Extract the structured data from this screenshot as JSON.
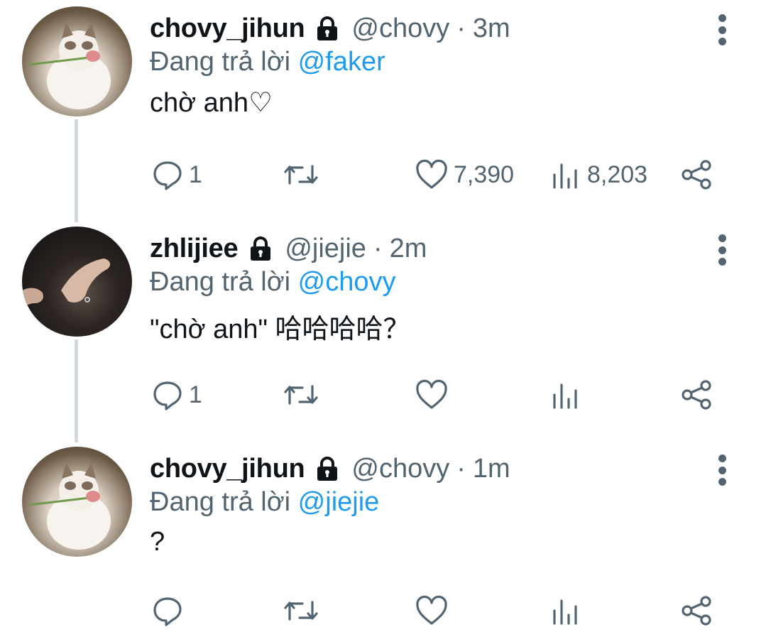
{
  "tweets": [
    {
      "name": "chovy_jihun",
      "handle": "@chovy",
      "separator": "·",
      "time": "3m",
      "reply_prefix": "Đang trả lời",
      "reply_to": "@faker",
      "text": "chờ anh♡",
      "counts": {
        "reply": "1",
        "retweet": "",
        "like": "7,390",
        "views": "8,203"
      },
      "avatar_icon": "cat-avatar"
    },
    {
      "name": "zhlijiee",
      "handle": "@jiejie",
      "separator": "·",
      "time": "2m",
      "reply_prefix": "Đang trả lời",
      "reply_to": "@chovy",
      "text": "\"chờ anh\" 哈哈哈哈？",
      "counts": {
        "reply": "1",
        "retweet": "",
        "like": "",
        "views": ""
      },
      "avatar_icon": "hands-avatar"
    },
    {
      "name": "chovy_jihun",
      "handle": "@chovy",
      "separator": "·",
      "time": "1m",
      "reply_prefix": "Đang trả lời",
      "reply_to": "@jiejie",
      "text": "?",
      "counts": {
        "reply": "",
        "retweet": "",
        "like": "",
        "views": ""
      },
      "avatar_icon": "cat-avatar"
    }
  ],
  "icons": [
    "lock-icon",
    "more-icon",
    "reply-icon",
    "retweet-icon",
    "like-icon",
    "views-icon",
    "share-icon"
  ],
  "colors": {
    "text": "#0f1419",
    "secondary": "#536471",
    "mention": "#1d9bf0",
    "thread_line": "#cfd9de"
  }
}
